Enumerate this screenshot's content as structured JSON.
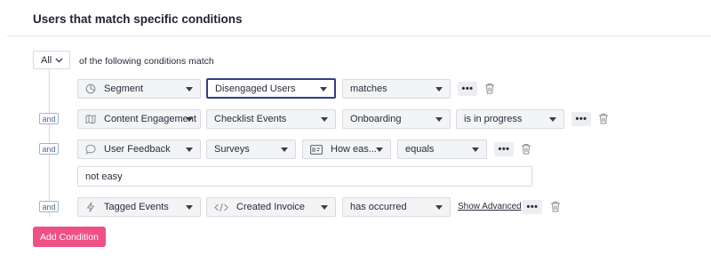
{
  "header": {
    "title": "Users that match specific conditions"
  },
  "match": {
    "mode": "All",
    "suffix": "of the following conditions match"
  },
  "connector": "and",
  "rows": [
    {
      "type": "Segment",
      "type_icon": "pie-chart-icon",
      "value": "Disengaged Users",
      "operator": "matches"
    },
    {
      "type": "Content Engagement",
      "type_icon": "map-icon",
      "value": "Checklist Events",
      "sub": "Onboarding",
      "operator": "is in progress"
    },
    {
      "type": "User Feedback",
      "type_icon": "speech-bubble-icon",
      "value": "Surveys",
      "question_icon": "survey-question-icon",
      "question": "How eas...",
      "operator": "equals",
      "answer": "not easy"
    },
    {
      "type": "Tagged Events",
      "type_icon": "lightning-icon",
      "value_icon": "code-icon",
      "value": "Created Invoice",
      "operator": "has occurred",
      "advanced": "Show Advanced"
    }
  ],
  "more_glyph": "•••",
  "add_button": "Add Condition",
  "colors": {
    "accent": "#ef5185",
    "focus": "#2f3f8f",
    "and_border": "#9fb3cd"
  }
}
